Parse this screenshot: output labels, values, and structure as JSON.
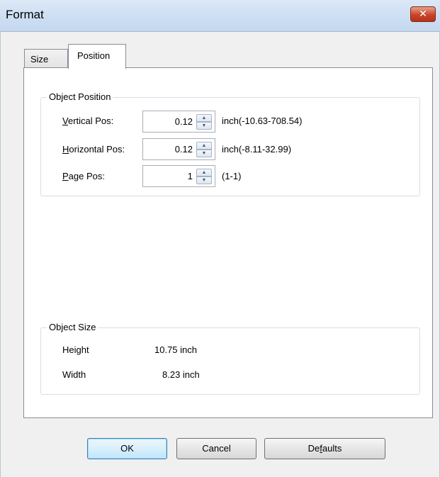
{
  "window": {
    "title": "Format",
    "close_label": "✕"
  },
  "tabs": [
    {
      "label": "Size",
      "active": false
    },
    {
      "label": "Position",
      "active": true
    }
  ],
  "object_position": {
    "group_label": "Object Position",
    "vertical": {
      "label_mnemonic": "V",
      "label_rest": "ertical Pos:",
      "value": "0.12",
      "range": "inch(-10.63-708.54)"
    },
    "horizontal": {
      "label_mnemonic": "H",
      "label_rest": "orizontal Pos:",
      "value": "0.12",
      "range": "inch(-8.11-32.99)"
    },
    "page": {
      "label_mnemonic": "P",
      "label_rest": "age Pos:",
      "value": "1",
      "range": "(1-1)"
    }
  },
  "object_size": {
    "group_label": "Object Size",
    "height_label": "Height",
    "height_value": "10.75 inch",
    "width_label": "Width",
    "width_value": "8.23 inch"
  },
  "buttons": {
    "ok": "OK",
    "cancel": "Cancel",
    "defaults_pre": "De",
    "defaults_mnemonic": "f",
    "defaults_post": "aults"
  }
}
